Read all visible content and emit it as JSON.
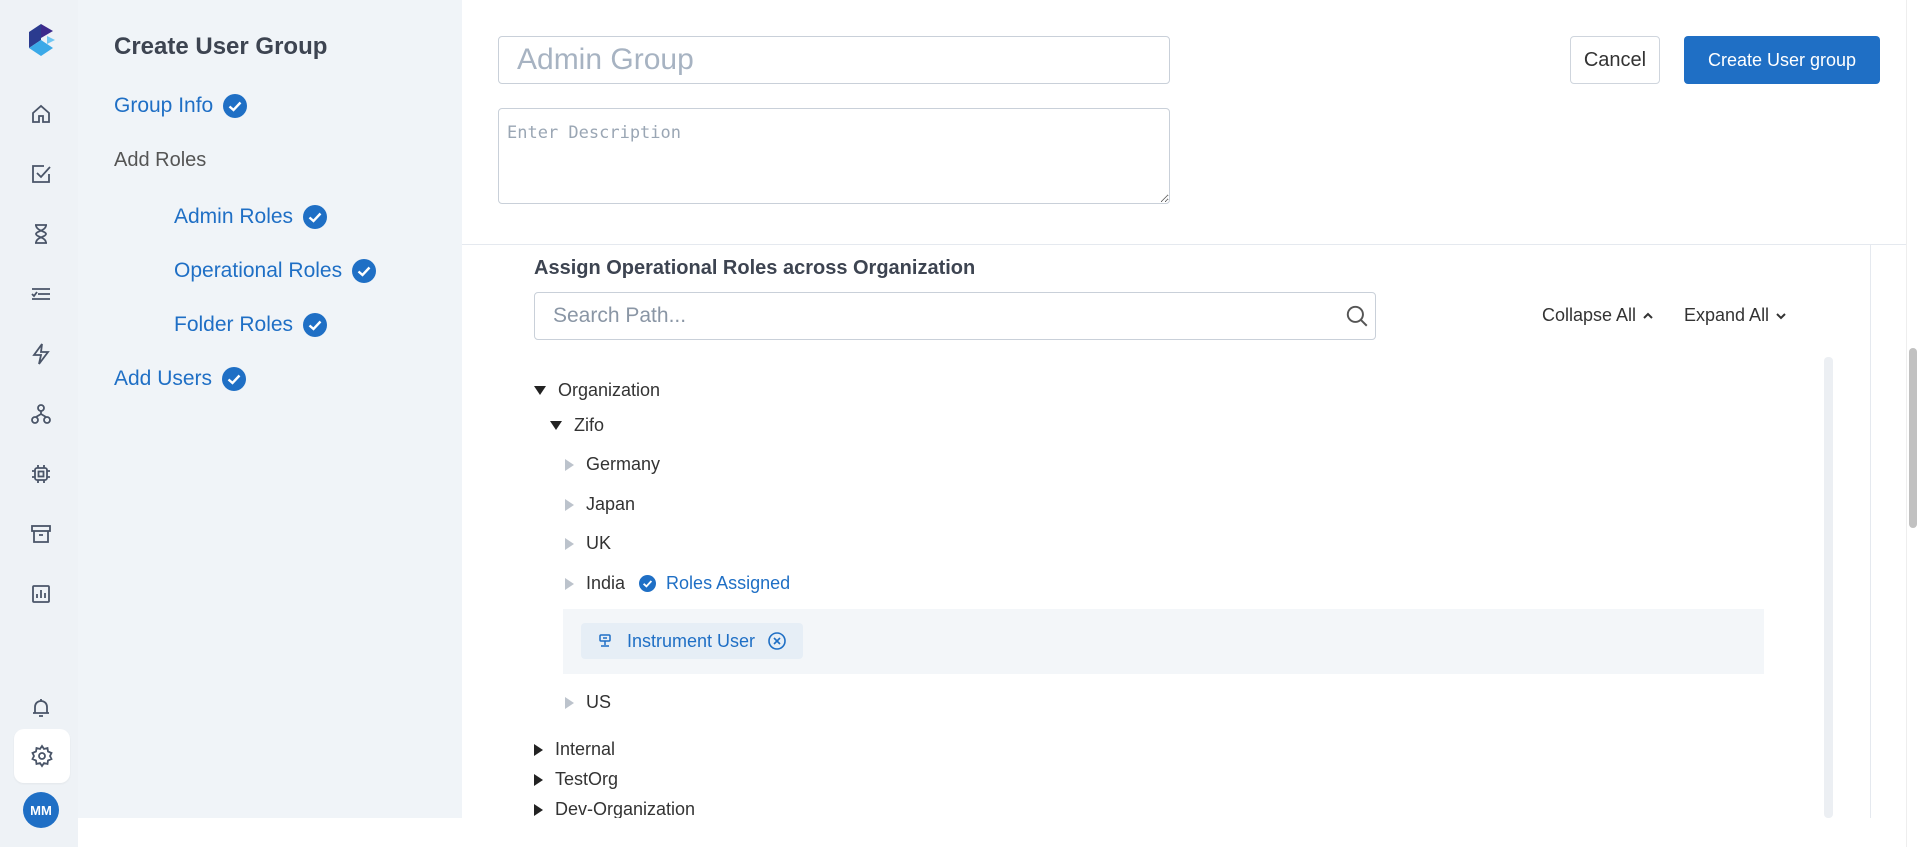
{
  "rail": {
    "icons": [
      "home-icon",
      "tasks-icon",
      "hourglass-icon",
      "list-icon",
      "lightning-icon",
      "hierarchy-icon",
      "chip-icon",
      "archive-icon",
      "chart-icon",
      "bell-icon",
      "gear-icon"
    ],
    "avatar_initials": "MM"
  },
  "steps": {
    "title": "Create User Group",
    "items": [
      {
        "label": "Group Info",
        "complete": true
      },
      {
        "label": "Add Roles",
        "complete": false
      },
      {
        "label": "Admin Roles",
        "complete": true
      },
      {
        "label": "Operational Roles",
        "complete": true
      },
      {
        "label": "Folder Roles",
        "complete": true
      },
      {
        "label": "Add Users",
        "complete": true
      }
    ]
  },
  "form": {
    "name_placeholder": "Admin Group",
    "description_placeholder": "Enter Description"
  },
  "actions": {
    "cancel_label": "Cancel",
    "create_label": "Create User group"
  },
  "roles": {
    "title": "Assign Operational Roles across Organization",
    "search_placeholder": "Search Path...",
    "collapse_all_label": "Collapse All",
    "expand_all_label": "Expand All",
    "tree": {
      "organization": "Organization",
      "zifo": "Zifo",
      "germany": "Germany",
      "japan": "Japan",
      "uk": "UK",
      "india": "India",
      "india_status": "Roles Assigned",
      "india_role": "Instrument User",
      "us": "US",
      "internal": "Internal",
      "testorg": "TestOrg",
      "dev_organization": "Dev-Organization"
    }
  },
  "colors": {
    "accent": "#1f6fc5",
    "panel_bg": "#f0f4f8",
    "rail_bg": "#eef2f6"
  }
}
